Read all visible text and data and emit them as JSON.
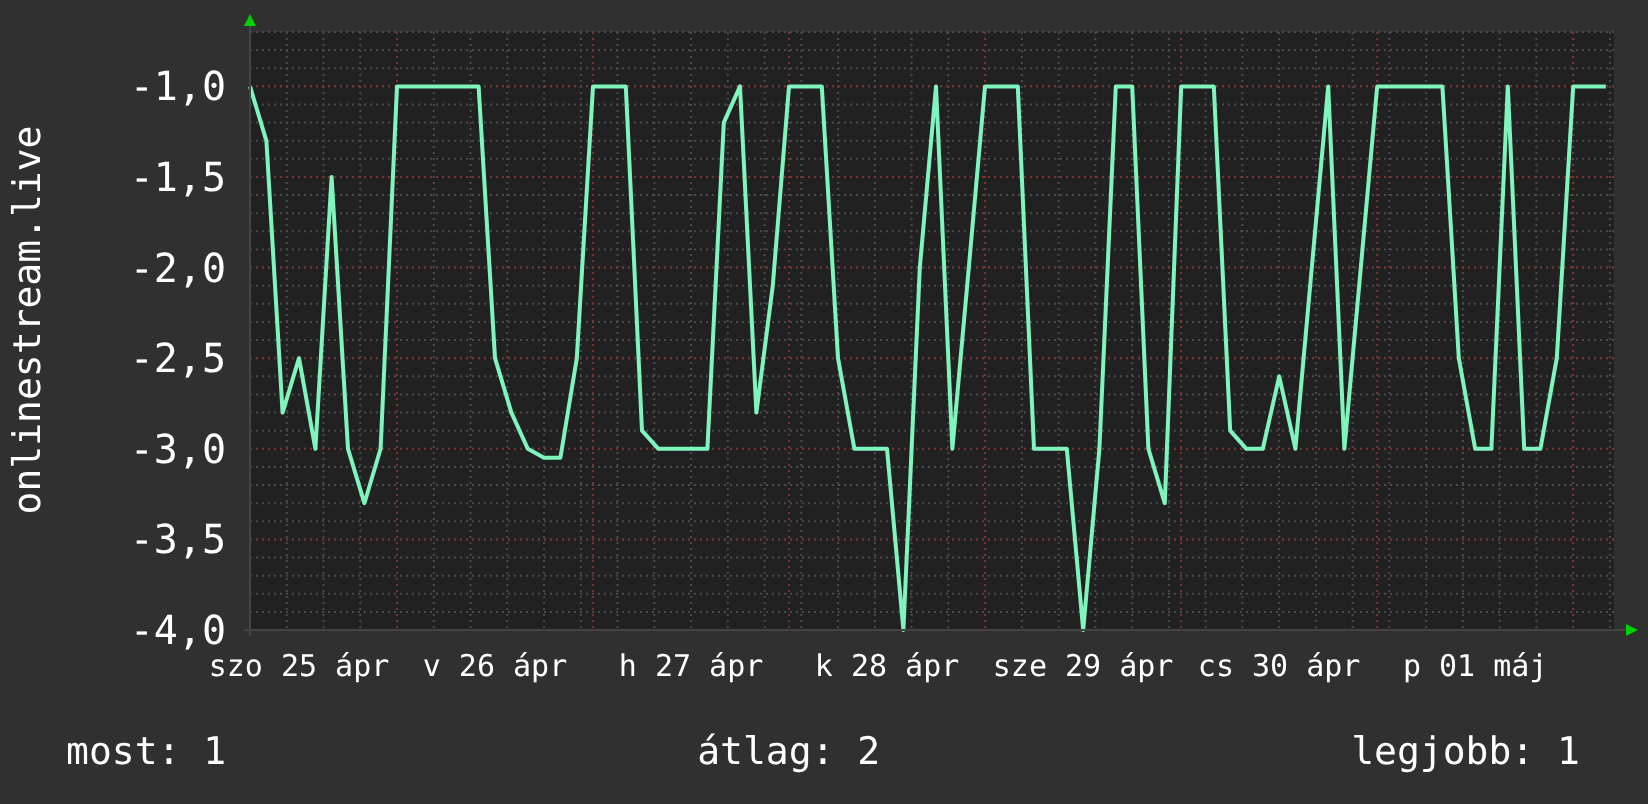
{
  "graph": {
    "chart_data": {
      "type": "line",
      "grid": true,
      "ylabel": "onlinestream.live",
      "ylim": [
        -4,
        -0.7
      ],
      "yticks": [
        {
          "value": -1,
          "label": "-1,0"
        },
        {
          "value": -1.5,
          "label": "-1,5"
        },
        {
          "value": -2,
          "label": "-2,0"
        },
        {
          "value": -2.5,
          "label": "-2,5"
        },
        {
          "value": -3,
          "label": "-3,0"
        },
        {
          "value": -3.5,
          "label": "-3,5"
        },
        {
          "value": -4,
          "label": "-4,0"
        }
      ],
      "categories": [
        null,
        null,
        null,
        "szo 25 ápr",
        null,
        null,
        null,
        null,
        null,
        null,
        null,
        null,
        null,
        null,
        null,
        "v 26 ápr",
        null,
        null,
        null,
        null,
        null,
        null,
        null,
        null,
        null,
        null,
        null,
        "h 27 ápr",
        null,
        null,
        null,
        null,
        null,
        null,
        null,
        null,
        null,
        null,
        null,
        "k 28 ápr",
        null,
        null,
        null,
        null,
        null,
        null,
        null,
        null,
        null,
        null,
        null,
        "sze 29 ápr",
        null,
        null,
        null,
        null,
        null,
        null,
        null,
        null,
        null,
        null,
        null,
        "cs 30 ápr",
        null,
        null,
        null,
        null,
        null,
        null,
        null,
        null,
        null,
        null,
        null,
        "p 01 máj",
        null,
        null,
        null,
        null,
        null,
        null,
        null,
        null
      ],
      "series": [
        {
          "color": "#7ff5bd",
          "values": [
            -1.0,
            -1.3,
            -2.8,
            -2.5,
            -3.0,
            -1.5,
            -3.0,
            -3.3,
            -3.0,
            -1.0,
            -1.0,
            -1.0,
            -1.0,
            -1.0,
            -1.0,
            -2.5,
            -2.8,
            -3.0,
            -3.05,
            -3.05,
            -2.5,
            -1.0,
            -1.0,
            -1.0,
            -2.9,
            -3.0,
            -3.0,
            -3.0,
            -3.0,
            -1.2,
            -1.0,
            -2.8,
            -2.1,
            -1.0,
            -1.0,
            -1.0,
            -2.5,
            -3.0,
            -3.0,
            -3.0,
            -4.0,
            -2.0,
            -1.0,
            -3.0,
            -2.0,
            -1.0,
            -1.0,
            -1.0,
            -3.0,
            -3.0,
            -3.0,
            -4.0,
            -3.0,
            -1.0,
            -1.0,
            -3.0,
            -3.3,
            -1.0,
            -1.0,
            -1.0,
            -2.9,
            -3.0,
            -3.0,
            -2.6,
            -3.0,
            -2.0,
            -1.0,
            -3.0,
            -2.0,
            -1.0,
            -1.0,
            -1.0,
            -1.0,
            -1.0,
            -2.5,
            -3.0,
            -3.0,
            -1.0,
            -3.0,
            -3.0,
            -2.5,
            -1.0,
            -1.0,
            -1.0
          ]
        }
      ]
    }
  },
  "legend": [
    "most: 1",
    "átlag: 2",
    "legjobb: 1"
  ]
}
